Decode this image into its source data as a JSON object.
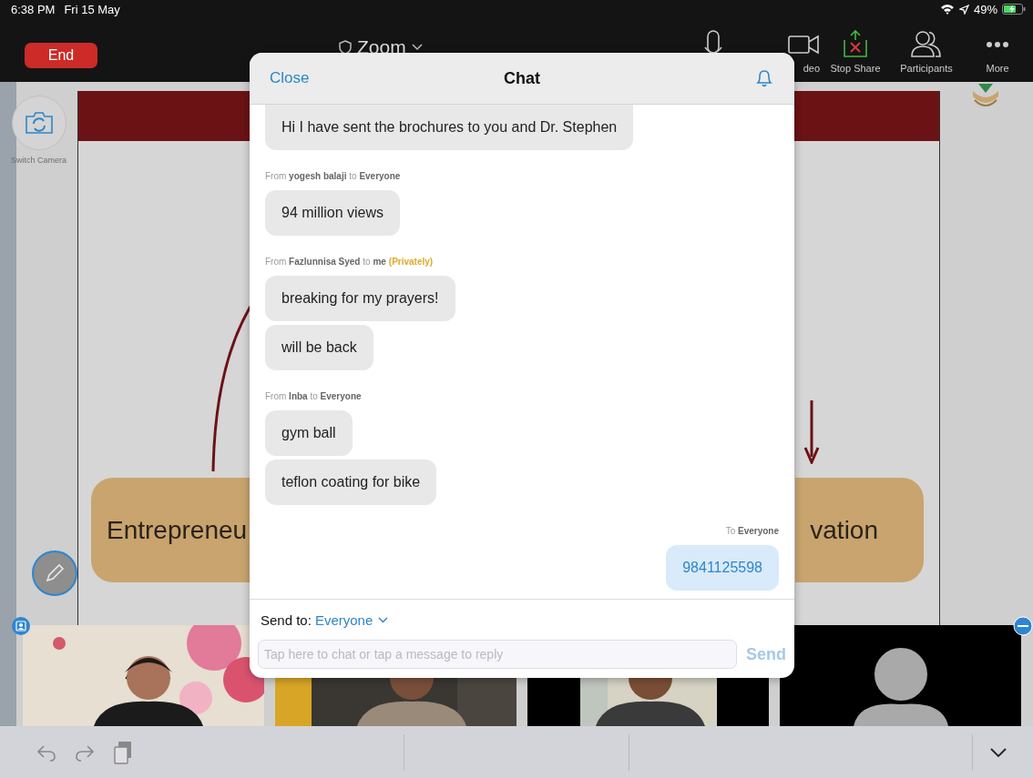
{
  "status_bar": {
    "time": "6:38 PM",
    "date": "Fri 15 May",
    "battery": "49%"
  },
  "toolbar": {
    "end_button": "End",
    "meeting_title": "Zoom",
    "buttons": [
      {
        "kind": "mic"
      },
      {
        "kind": "video",
        "label": "deo"
      },
      {
        "kind": "share",
        "label": "Stop Share"
      },
      {
        "kind": "participants",
        "label": "Participants"
      },
      {
        "kind": "more",
        "label": "More"
      }
    ]
  },
  "side_controls": {
    "switch_camera": "Switch Camera"
  },
  "slide": {
    "left_box": "Entrepreneu",
    "right_box": "vation"
  },
  "video_tiles": [
    {
      "kind": "picture"
    },
    {
      "kind": "picture"
    },
    {
      "kind": "picture"
    },
    {
      "kind": "avatar"
    }
  ],
  "chat": {
    "close": "Close",
    "title": "Chat",
    "messages": [
      {
        "kind": "incoming",
        "text": "Hi I have sent the brochures to you and Dr. Stephen"
      },
      {
        "kind": "meta",
        "text": "From **yogesh balaji** to **Everyone**"
      },
      {
        "kind": "incoming",
        "text": "94 million views"
      },
      {
        "kind": "meta",
        "text": "From **Fazlunnisa Syed** to **me**",
        "note": "(Privately)"
      },
      {
        "kind": "incoming",
        "text": "breaking for my prayers!"
      },
      {
        "kind": "incoming",
        "text": "will be back"
      },
      {
        "kind": "meta",
        "text": "From **Inba** to **Everyone**"
      },
      {
        "kind": "incoming",
        "text": "gym ball"
      },
      {
        "kind": "incoming",
        "text": "teflon coating for bike"
      },
      {
        "kind": "meta_out",
        "text": "To **Everyone**"
      },
      {
        "kind": "outgoing",
        "text": "9841125598"
      }
    ],
    "send_to_label": "Send to:",
    "send_to_value": "Everyone",
    "placeholder": "Tap here to chat or tap a message to reply",
    "send": {
      "label": "Send",
      "disabled": true
    }
  }
}
